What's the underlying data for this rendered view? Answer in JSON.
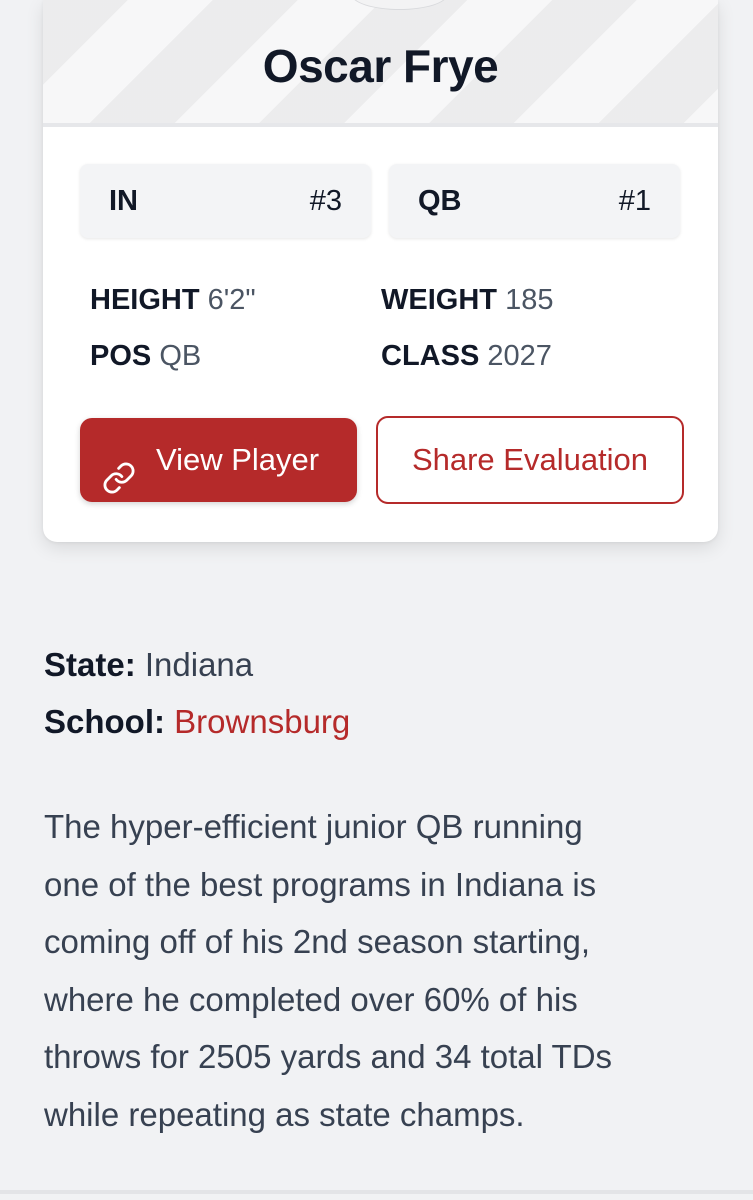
{
  "player": {
    "name": "Oscar Frye"
  },
  "rankings": [
    {
      "label": "IN",
      "rank": "#3"
    },
    {
      "label": "QB",
      "rank": "#1"
    }
  ],
  "stats": {
    "height": {
      "label": "HEIGHT",
      "value": "6'2\""
    },
    "weight": {
      "label": "WEIGHT",
      "value": "185"
    },
    "pos": {
      "label": "POS",
      "value": "QB"
    },
    "class": {
      "label": "CLASS",
      "value": "2027"
    }
  },
  "buttons": {
    "view_player": "View Player",
    "view_player_icon": "link-icon",
    "share_evaluation": "Share Evaluation"
  },
  "info": {
    "state_label": "State:",
    "state_value": "Indiana",
    "school_label": "School:",
    "school_value": "Brownsburg"
  },
  "description_lines": [
    "The hyper-efficient junior QB running",
    "one of the best programs in Indiana is",
    "coming off of his 2nd season starting,",
    "where he completed over 60% of his",
    "throws for 2505 yards and 34 total TDs",
    "while repeating as state champs."
  ],
  "colors": {
    "accent": "#b52a2a",
    "background": "#f1f2f4",
    "text_dark": "#111827",
    "text_muted": "#4b5563"
  }
}
